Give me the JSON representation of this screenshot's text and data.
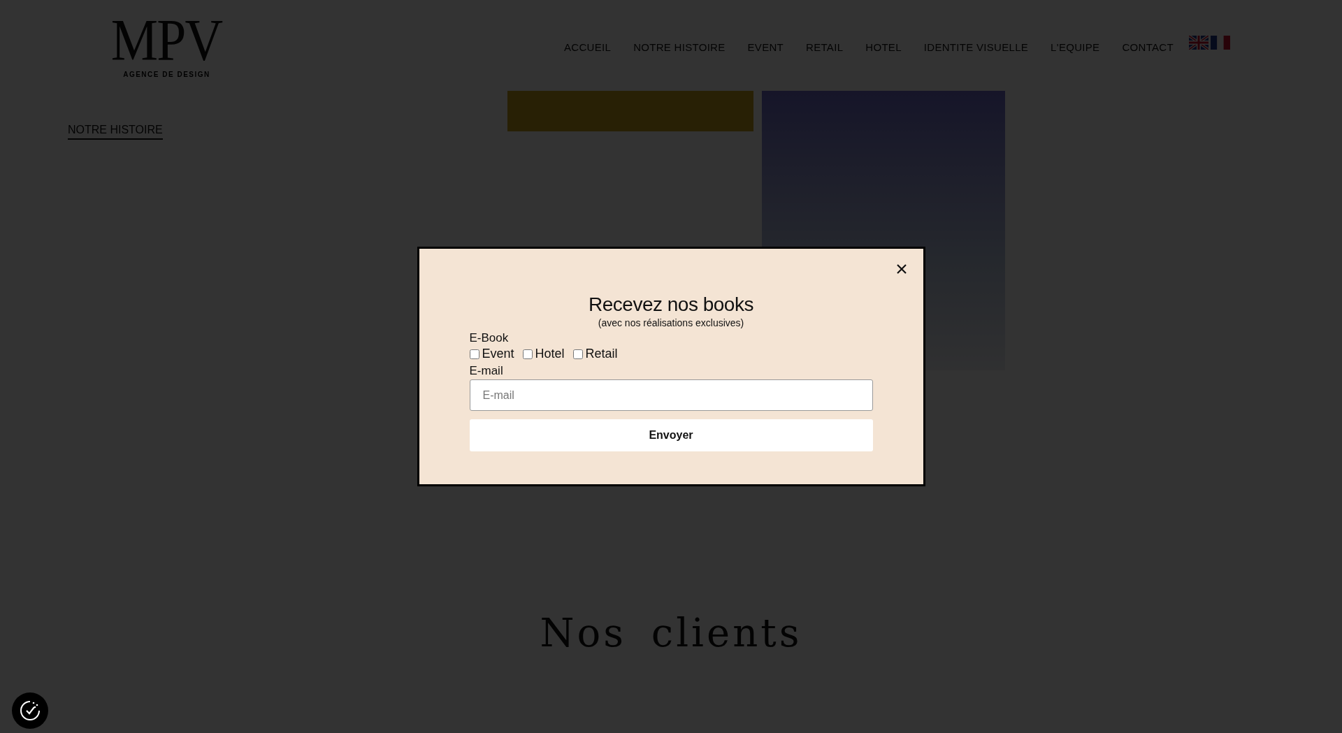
{
  "header": {
    "logo": {
      "title": "MPV",
      "subtitle": "AGENCE DE DESIGN"
    },
    "nav": [
      {
        "label": "ACCUEIL"
      },
      {
        "label": "NOTRE HISTOIRE"
      },
      {
        "label": "EVENT"
      },
      {
        "label": "RETAIL"
      },
      {
        "label": "HOTEL"
      },
      {
        "label": "IDENTITE VISUELLE"
      },
      {
        "label": "L'EQUIPE"
      },
      {
        "label": "CONTACT"
      }
    ]
  },
  "intro": {
    "link": "NOTRE HISTOIRE"
  },
  "clients": {
    "title": "Nos clients"
  },
  "modal": {
    "title": "Recevez nos books",
    "subtitle": "(avec nos réalisations exclusives)",
    "group_label": "E-Book",
    "options": [
      {
        "label": "Event",
        "checked": false
      },
      {
        "label": "Hotel",
        "checked": false
      },
      {
        "label": "Retail",
        "checked": false
      }
    ],
    "email_label": "E-mail",
    "email": {
      "placeholder": "E-mail"
    },
    "submit": "Envoyer"
  }
}
